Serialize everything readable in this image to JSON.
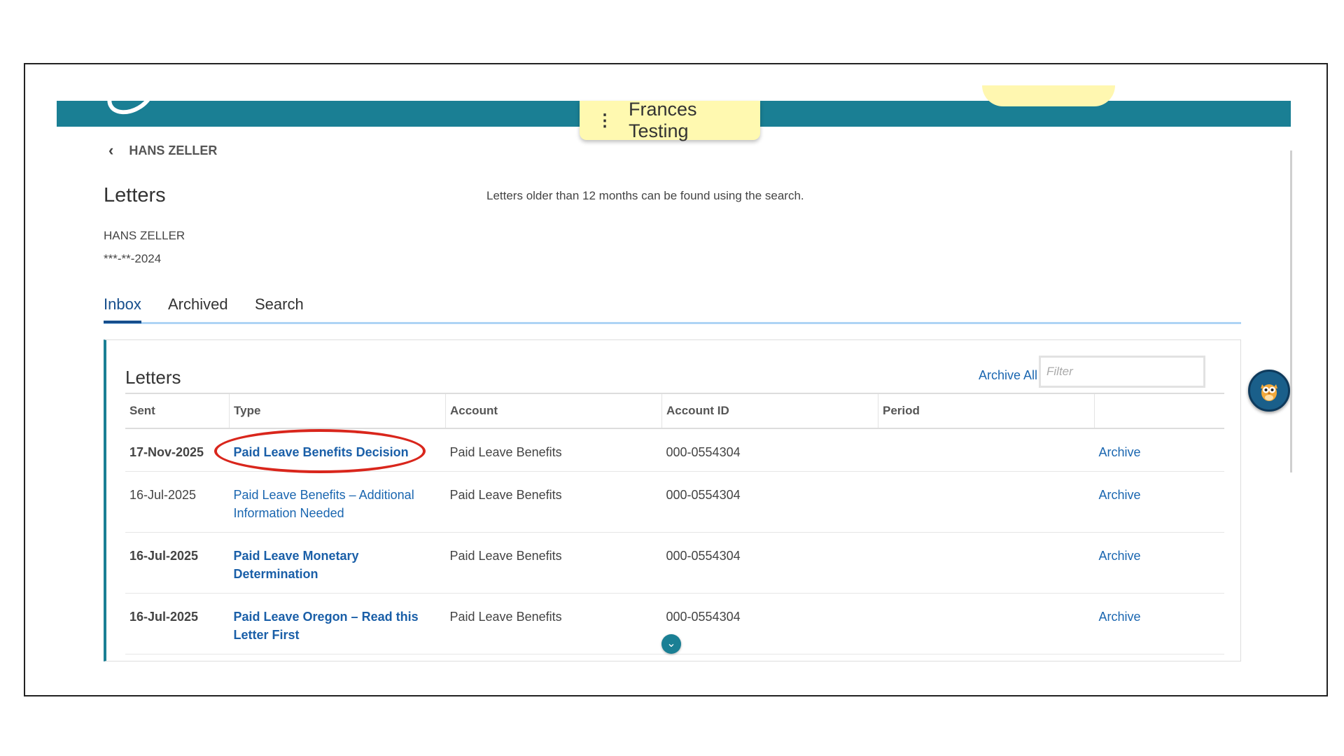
{
  "header": {
    "user_badge": "Frances Testing",
    "menu_icon": "kebab-menu-icon"
  },
  "breadcrumb": {
    "back_label": "HANS ZELLER"
  },
  "page": {
    "title": "Letters",
    "notice": "Letters older than 12 months can be found using the search.",
    "account_name": "HANS ZELLER",
    "account_ssn": "***-**-2024"
  },
  "tabs": [
    {
      "label": "Inbox",
      "active": true
    },
    {
      "label": "Archived",
      "active": false
    },
    {
      "label": "Search",
      "active": false
    }
  ],
  "panel": {
    "title": "Letters",
    "archive_all_label": "Archive All",
    "filter_placeholder": "Filter"
  },
  "table": {
    "columns": [
      "Sent",
      "Type",
      "Account",
      "Account ID",
      "Period",
      ""
    ],
    "rows": [
      {
        "sent": "17-Nov-2025",
        "type": "Paid Leave Benefits Decision",
        "account": "Paid Leave Benefits",
        "account_id": "000-0554304",
        "period": "",
        "action": "Archive",
        "unread": true
      },
      {
        "sent": "16-Jul-2025",
        "type": "Paid Leave Benefits – Additional Information Needed",
        "account": "Paid Leave Benefits",
        "account_id": "000-0554304",
        "period": "",
        "action": "Archive",
        "unread": false
      },
      {
        "sent": "16-Jul-2025",
        "type": "Paid Leave Monetary Determination",
        "account": "Paid Leave Benefits",
        "account_id": "000-0554304",
        "period": "",
        "action": "Archive",
        "unread": true
      },
      {
        "sent": "16-Jul-2025",
        "type": "Paid Leave Oregon – Read this Letter First",
        "account": "Paid Leave Benefits",
        "account_id": "000-0554304",
        "period": "",
        "action": "Archive",
        "unread": true
      }
    ]
  },
  "colors": {
    "brand_teal": "#1a7f94",
    "link_blue": "#1a66b0",
    "highlight_red": "#d9261c",
    "badge_yellow": "#fff9b0"
  }
}
